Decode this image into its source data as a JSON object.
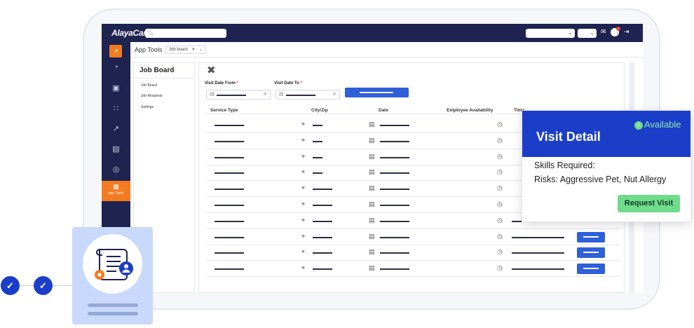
{
  "app": {
    "logo": "AlayaCare",
    "search_icon": "search-icon",
    "tab_title": "App Tools",
    "tab_chip": "Job board",
    "brand_color": "#1e2350",
    "accent_color": "#f47b20",
    "primary_button_color": "#2f5fd9"
  },
  "leftnav": {
    "icons": [
      "gauge-icon",
      "camera-icon",
      "people-icon",
      "chart-icon",
      "calendar-icon",
      "settings-icon"
    ],
    "active_label": "App Tools"
  },
  "subnav": {
    "title": "Job Board",
    "items": [
      "Job Board",
      "Job Requests",
      "Settings"
    ]
  },
  "filters": {
    "from_label": "Visit Date From",
    "to_label": "Visit Date To",
    "required_mark": "*"
  },
  "table": {
    "columns": [
      "Service Type",
      "City/Zip",
      "Date",
      "Employee Availability",
      "Time"
    ],
    "row_count": 10
  },
  "visit_card": {
    "status": "Available",
    "title": "Visit Detail",
    "skills": "Skills Required:",
    "risks": "Risks: Aggressive Pet, Nut Allergy",
    "button": "Request Visit",
    "header_color": "#1b3ec9",
    "button_color": "#6fdc8c"
  }
}
